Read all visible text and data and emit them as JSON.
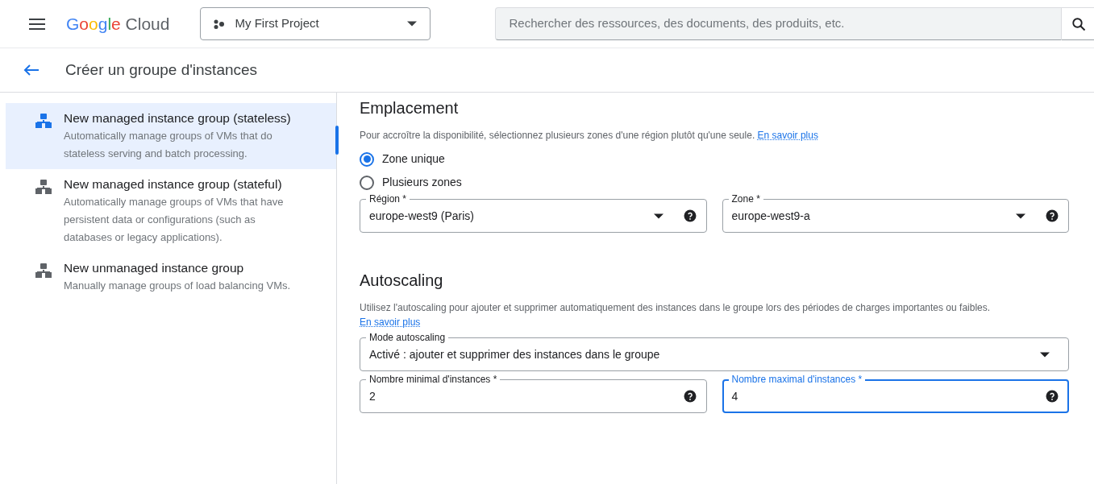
{
  "header": {
    "logo": {
      "brand": "Google",
      "product": "Cloud"
    },
    "project": "My First Project",
    "search": {
      "placeholder": "Rechercher des ressources, des documents, des produits, etc."
    }
  },
  "page_title": "Créer un groupe d'instances",
  "sidebar": {
    "items": [
      {
        "title": "New managed instance group (stateless)",
        "description": "Automatically manage groups of VMs that do stateless serving and batch processing.",
        "selected": true
      },
      {
        "title": "New managed instance group (stateful)",
        "description": "Automatically manage groups of VMs that have persistent data or configurations (such as databases or legacy applications).",
        "selected": false
      },
      {
        "title": "New unmanaged instance group",
        "description": "Manually manage groups of load balancing VMs.",
        "selected": false
      }
    ]
  },
  "sections": [
    {
      "title": "Emplacement",
      "description": "Pour accroître la disponibilité, sélectionnez plusieurs zones d'une région plutôt qu'une seule.",
      "link": "En savoir plus",
      "radios": [
        {
          "label": "Zone unique",
          "selected": true
        },
        {
          "label": "Plusieurs zones",
          "selected": false
        }
      ],
      "field_rows": [
        [
          {
            "kind": "select",
            "label": "Région *",
            "value": "europe-west9 (Paris)",
            "help": true,
            "focused": false
          },
          {
            "kind": "select",
            "label": "Zone *",
            "value": "europe-west9-a",
            "help": true,
            "focused": false
          }
        ]
      ]
    },
    {
      "title": "Autoscaling",
      "description": "Utilisez l'autoscaling pour ajouter et supprimer automatiquement des instances dans le groupe lors des périodes de charges importantes ou faibles.",
      "link": "En savoir plus",
      "field_rows": [
        [
          {
            "kind": "select",
            "label": "Mode autoscaling",
            "value": "Activé : ajouter et supprimer des instances dans le groupe",
            "help": false,
            "focused": false
          }
        ],
        [
          {
            "kind": "input",
            "label": "Nombre minimal d'instances *",
            "value": "2",
            "help": true,
            "focused": false
          },
          {
            "kind": "input",
            "label": "Nombre maximal d'instances *",
            "value": "4",
            "help": true,
            "focused": true
          }
        ]
      ]
    }
  ]
}
